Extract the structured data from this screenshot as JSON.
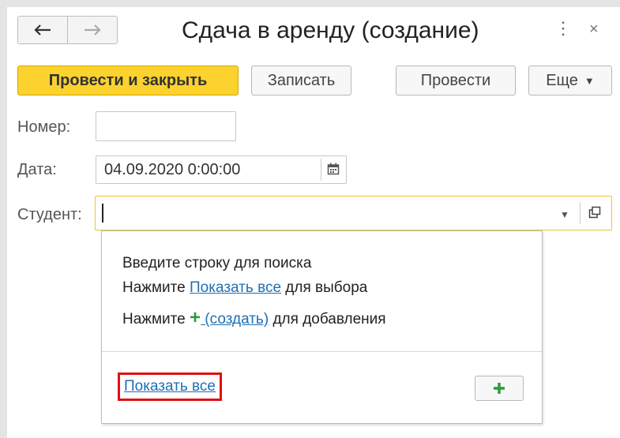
{
  "window": {
    "title": "Сдача в аренду (создание)",
    "back_icon": "arrow-left-icon",
    "forward_icon": "arrow-right-icon",
    "more_icon": "more-vertical-icon",
    "close_icon": "close-icon"
  },
  "toolbar": {
    "post_and_close": "Провести и закрыть",
    "save": "Записать",
    "post": "Провести",
    "more": "Еще"
  },
  "form": {
    "number_label": "Номер:",
    "number_value": "",
    "date_label": "Дата:",
    "date_value": "04.09.2020  0:00:00",
    "student_label": "Студент:",
    "student_value": ""
  },
  "popup": {
    "line1": "Введите строку для поиска",
    "line2_prefix": "Нажмите ",
    "line2_link": "Показать все",
    "line2_suffix": " для выбора",
    "line3_prefix": "Нажмите ",
    "line3_plus": "+",
    "line3_link": " (создать)",
    "line3_suffix": " для добавления",
    "show_all": "Показать все",
    "add_icon": "plus-icon"
  },
  "colors": {
    "primary_button": "#fbd22e",
    "link": "#1f6fb5",
    "plus_green": "#2a9d3c",
    "highlight_border": "#e01010",
    "active_field_border": "#f0c23a"
  }
}
